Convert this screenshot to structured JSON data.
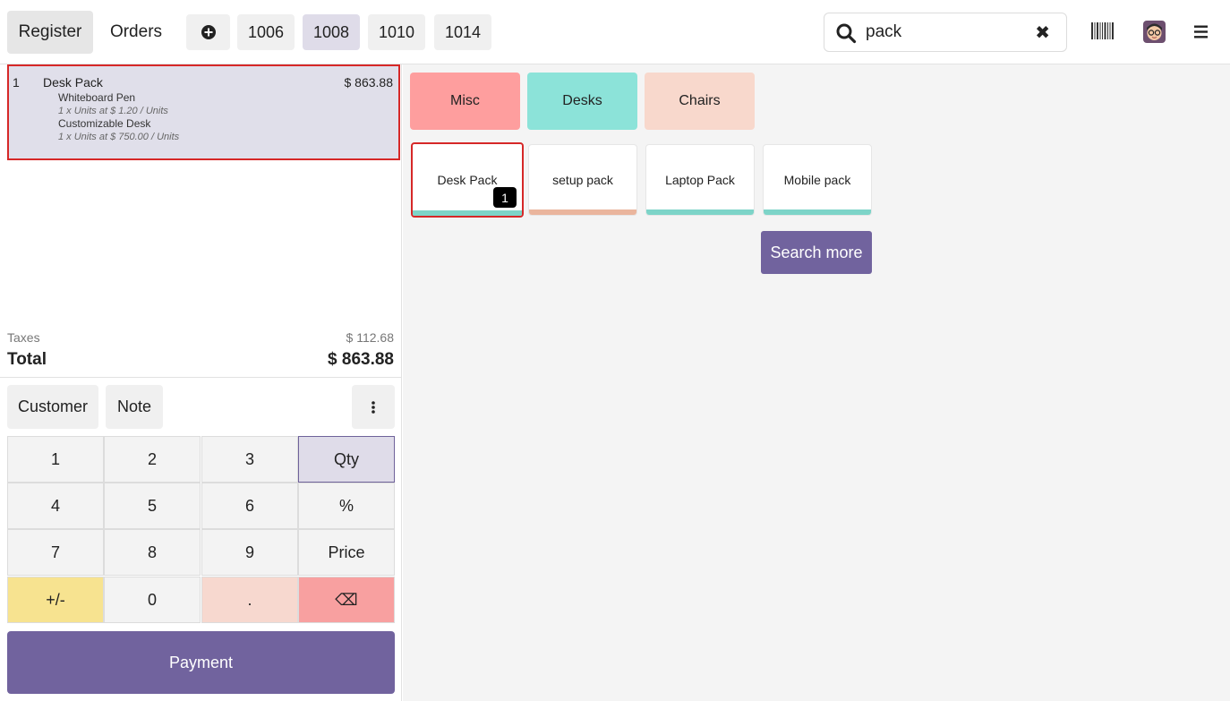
{
  "header": {
    "register_label": "Register",
    "orders_label": "Orders",
    "order_tabs": [
      "1006",
      "1008",
      "1010",
      "1014"
    ],
    "active_order": "1008",
    "search": {
      "value": "pack"
    }
  },
  "order": {
    "line": {
      "qty": "1",
      "name": "Desk Pack",
      "price": "$ 863.88",
      "components": [
        {
          "name": "Whiteboard Pen",
          "detail": "1 x Units at $ 1.20 / Units"
        },
        {
          "name": "Customizable Desk",
          "detail": "1 x Units at $ 750.00 / Units"
        }
      ]
    },
    "taxes_label": "Taxes",
    "taxes_value": "$ 112.68",
    "total_label": "Total",
    "total_value": "$ 863.88"
  },
  "actions": {
    "customer_label": "Customer",
    "note_label": "Note"
  },
  "numpad": {
    "keys": [
      "1",
      "2",
      "3",
      "Qty",
      "4",
      "5",
      "6",
      "%",
      "7",
      "8",
      "9",
      "Price",
      "+/-",
      "0",
      ".",
      "⌫"
    ],
    "active_mode": "Qty"
  },
  "payment_label": "Payment",
  "categories": [
    {
      "label": "Misc",
      "color": "#fe9e9e"
    },
    {
      "label": "Desks",
      "color": "#8ce3d9"
    },
    {
      "label": "Chairs",
      "color": "#f8d8cc"
    }
  ],
  "products": [
    {
      "name": "Desk Pack",
      "bar_color": "#7dd4c8",
      "qty_badge": "1"
    },
    {
      "name": "setup pack",
      "bar_color": "#eab59d"
    },
    {
      "name": "Laptop Pack",
      "bar_color": "#7dd4c8"
    },
    {
      "name": "Mobile pack",
      "bar_color": "#7dd4c8"
    }
  ],
  "search_more_label": "Search more",
  "icons": {
    "add_order": "plus-circle-icon",
    "search": "search-icon",
    "clear": "close-icon",
    "barcode": "barcode-icon",
    "avatar": "avatar",
    "menu": "hamburger-menu-icon",
    "more": "vertical-dots-icon"
  }
}
